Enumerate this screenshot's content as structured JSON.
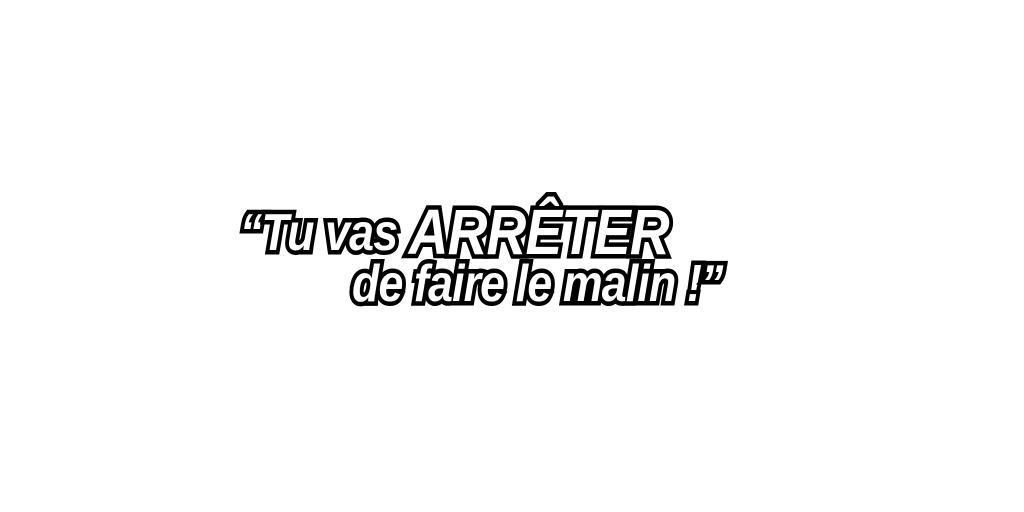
{
  "quote": {
    "open_quote": "“",
    "line1_small": "Tu vas ",
    "line1_big": "ARRÊTER",
    "line2": "de faire le malin !",
    "close_quote": "”"
  },
  "colors": {
    "background": "#ffffff",
    "text_fill": "#ffffff",
    "text_outline": "#000000"
  }
}
